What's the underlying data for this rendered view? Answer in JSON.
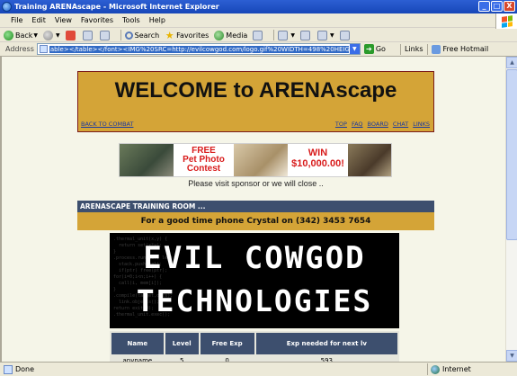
{
  "window": {
    "title": "Training ARENAscape - Microsoft Internet Explorer",
    "minimize": "_",
    "maximize": "□",
    "close": "X"
  },
  "menu": [
    "File",
    "Edit",
    "View",
    "Favorites",
    "Tools",
    "Help"
  ],
  "toolbar": {
    "back": "Back",
    "search": "Search",
    "favorites": "Favorites",
    "media": "Media"
  },
  "address": {
    "label": "Address",
    "url": "able></table></font><IMG%20SRC=http://evilcowgod.com/logo.gif%20WIDTH=498%20HEIGHT=163>",
    "go": "Go",
    "links": "Links",
    "hotmail": "Free Hotmail"
  },
  "page": {
    "welcome": "WELCOME to ARENAscape",
    "back_to_combat": "BACK TO COMBAT",
    "nav": [
      "TOP",
      "FAQ",
      "BOARD",
      "CHAT",
      "LINKS"
    ],
    "banner": {
      "free": "FREE",
      "contest_line1": "Pet Photo",
      "contest_line2": "Contest",
      "win": "WIN",
      "amount": "$10,000.00!"
    },
    "sponsor": "Please visit sponsor or we will close ..",
    "training_head": "ARENASCAPE TRAINING ROOM ...",
    "phone": "For a good time phone Crystal on (342) 3453 7654",
    "evil_line1": "EVIL COWGOD",
    "evil_line2": "TECHNOLOGIES",
    "table": {
      "headers": [
        "Name",
        "Level",
        "Free Exp",
        "Exp needed for next lv"
      ],
      "row": [
        "anyname",
        "5",
        "0",
        "593"
      ]
    }
  },
  "status": {
    "text": "Done",
    "zone": "Internet"
  },
  "colors": {
    "gold": "#d4a437",
    "navy": "#3d4f6e",
    "page_bg": "#f5f5e8"
  }
}
